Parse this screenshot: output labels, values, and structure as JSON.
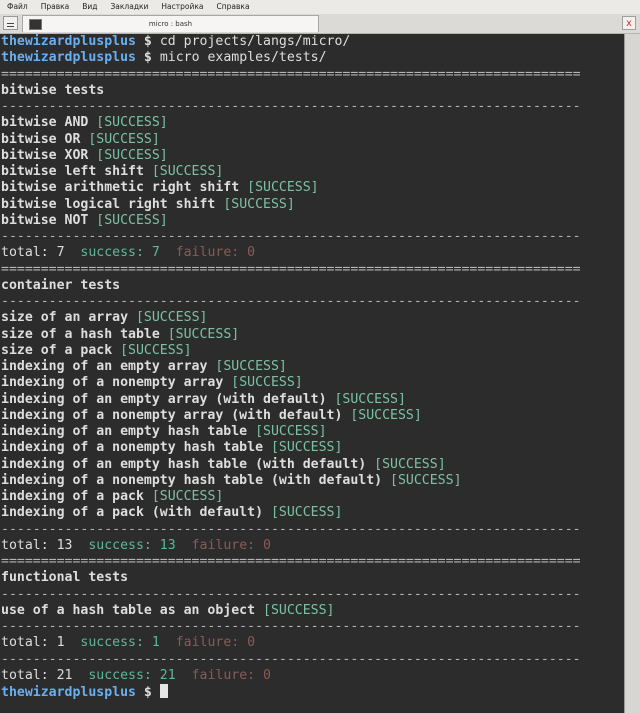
{
  "menu": [
    "Файл",
    "Правка",
    "Вид",
    "Закладки",
    "Настройка",
    "Справка"
  ],
  "tab": {
    "title": "micro : bash"
  },
  "close_glyph": "x",
  "terminal": {
    "user": "thewizardplusplus",
    "prompt_symbol": "$",
    "commands": [
      "cd projects/langs/micro/",
      "micro examples/tests/"
    ],
    "double_separator": "=========================================================================",
    "single_separator": "-------------------------------------------------------------------------",
    "status_label": "[SUCCESS]",
    "groups": [
      {
        "name": "bitwise tests",
        "tests": [
          "bitwise AND",
          "bitwise OR",
          "bitwise XOR",
          "bitwise left shift",
          "bitwise arithmetic right shift",
          "bitwise logical right shift",
          "bitwise NOT"
        ],
        "total": "total: 7",
        "success": "success: 7",
        "failure": "failure: 0"
      },
      {
        "name": "container tests",
        "tests": [
          "size of an array",
          "size of a hash table",
          "size of a pack",
          "indexing of an empty array",
          "indexing of a nonempty array",
          "indexing of an empty array (with default)",
          "indexing of a nonempty array (with default)",
          "indexing of an empty hash table",
          "indexing of a nonempty hash table",
          "indexing of an empty hash table (with default)",
          "indexing of a nonempty hash table (with default)",
          "indexing of a pack",
          "indexing of a pack (with default)"
        ],
        "total": "total: 13",
        "success": "success: 13",
        "failure": "failure: 0"
      },
      {
        "name": "functional tests",
        "tests": [
          "use of a hash table as an object"
        ],
        "total": "total: 1",
        "success": "success: 1",
        "failure": "failure: 0"
      }
    ],
    "summary": {
      "total": "total: 21",
      "success": "success: 21",
      "failure": "failure: 0"
    }
  }
}
